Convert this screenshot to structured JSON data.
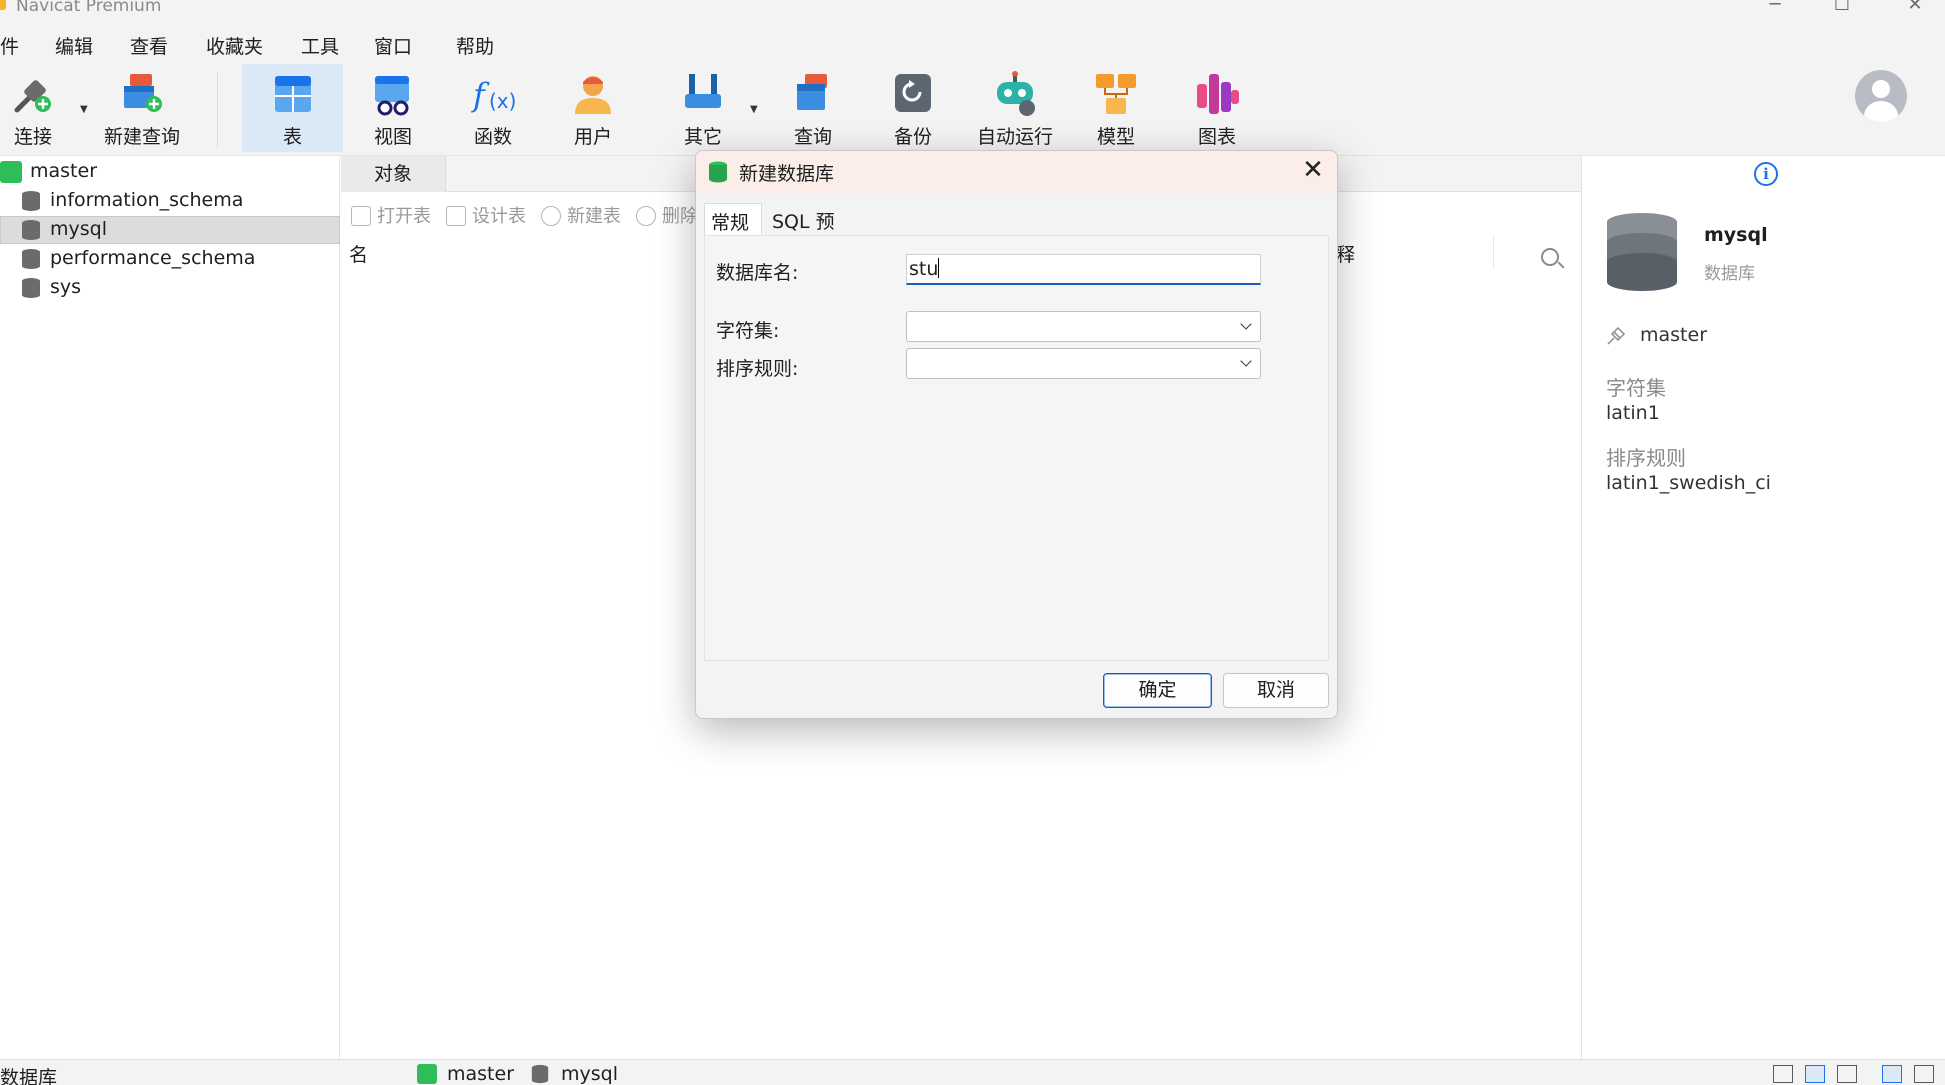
{
  "window": {
    "title": "Navicat Premium"
  },
  "menu": {
    "items": [
      "件",
      "编辑",
      "查看",
      "收藏夹",
      "工具",
      "窗口",
      "帮助"
    ]
  },
  "toolbar": {
    "connect": "连接",
    "new_query": "新建查询",
    "table": "表",
    "view": "视图",
    "function": "函数",
    "user": "用户",
    "other": "其它",
    "query": "查询",
    "backup": "备份",
    "automation": "自动运行",
    "model": "模型",
    "chart": "图表"
  },
  "tree": {
    "connection": "master",
    "databases": [
      "information_schema",
      "mysql",
      "performance_schema",
      "sys"
    ],
    "selected": "mysql"
  },
  "center": {
    "tab_label": "对象",
    "tools": {
      "open_table": "打开表",
      "design_table": "设计表",
      "new_table": "新建表",
      "delete": "删除"
    },
    "column_name": "名",
    "column_comment": "释"
  },
  "info": {
    "name": "mysql",
    "type": "数据库",
    "connection": "master",
    "charset_label": "字符集",
    "charset_value": "latin1",
    "collation_label": "排序规则",
    "collation_value": "latin1_swedish_ci"
  },
  "statusbar": {
    "left": "数据库",
    "conn": "master",
    "db": "mysql"
  },
  "dialog": {
    "title": "新建数据库",
    "tabs": [
      "常规",
      "SQL 预览"
    ],
    "db_name_label": "数据库名:",
    "db_name_value": "stu",
    "charset_label": "字符集:",
    "charset_value": "",
    "collation_label": "排序规则:",
    "collation_value": "",
    "ok": "确定",
    "cancel": "取消"
  },
  "colors": {
    "accent": "#1a73e8",
    "selection": "#dbe8f6",
    "conn_green": "#2fbd5a"
  }
}
